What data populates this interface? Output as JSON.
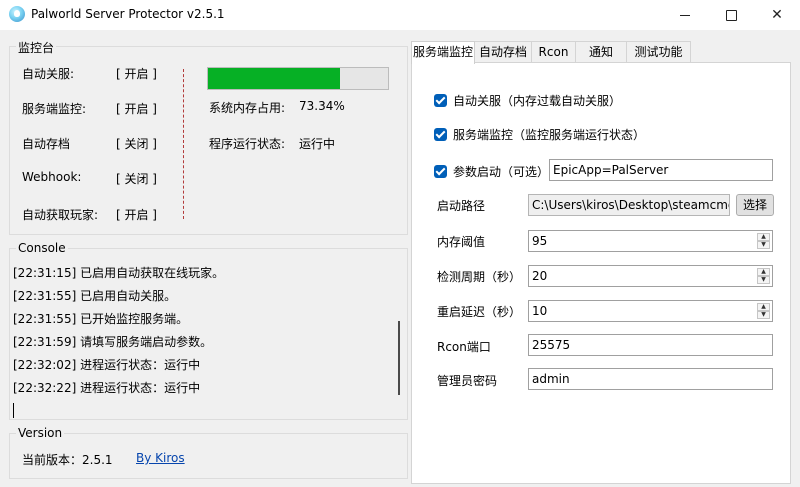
{
  "window": {
    "title": "Palworld Server Protector v2.5.1"
  },
  "monitor": {
    "title": "监控台",
    "rows": [
      {
        "label": "自动关服:",
        "value": "[ 开启 ]"
      },
      {
        "label": "服务端监控:",
        "value": "[ 开启 ]"
      },
      {
        "label": "自动存档",
        "value": "[ 关闭 ]"
      },
      {
        "label": "Webhook:",
        "value": "[ 关闭 ]"
      },
      {
        "label": "自动获取玩家:",
        "value": "[ 开启 ]"
      }
    ],
    "memory_fraction": 0.7334,
    "memory_label": "系统内存占用:",
    "memory_value": "73.34%",
    "status_label": "程序运行状态:",
    "status_value": "运行中",
    "accent_color": "#06b025"
  },
  "console": {
    "title": "Console",
    "lines": [
      "[22:31:15] 已启用自动获取在线玩家。",
      "[22:31:55] 已启用自动关服。",
      "[22:31:55] 已开始监控服务端。",
      "[22:31:59] 请填写服务端启动参数。",
      "[22:32:02] 进程运行状态：运行中",
      "[22:32:22] 进程运行状态：运行中"
    ]
  },
  "version": {
    "title": "Version",
    "label": "当前版本：2.5.1",
    "link": "By Kiros"
  },
  "tabs": [
    {
      "label": "服务端监控",
      "active": true
    },
    {
      "label": "自动存档",
      "active": false
    },
    {
      "label": "Rcon",
      "active": false
    },
    {
      "label": "通知",
      "active": false
    },
    {
      "label": "测试功能",
      "active": false
    }
  ],
  "settings": {
    "auto_shutdown": {
      "label": "自动关服（内存过载自动关服）",
      "checked": true
    },
    "server_monitor": {
      "label": "服务端监控（监控服务端运行状态）",
      "checked": true
    },
    "launch_args": {
      "label": "参数启动（可选）",
      "checked": true,
      "value": "EpicApp=PalServer"
    },
    "start_path": {
      "label": "启动路径",
      "value": "C:\\Users\\kiros\\Desktop\\steamcmd",
      "button": "选择"
    },
    "memory_threshold": {
      "label": "内存阈值",
      "value": "95"
    },
    "check_interval": {
      "label": "检测周期（秒）",
      "value": "20"
    },
    "restart_delay": {
      "label": "重启延迟（秒）",
      "value": "10"
    },
    "rcon_port": {
      "label": "Rcon端口",
      "value": "25575"
    },
    "admin_password": {
      "label": "管理员密码",
      "value": "admin"
    }
  },
  "icons": {
    "app": "palworld-app-icon",
    "minimize": "minimize-icon",
    "maximize": "maximize-icon",
    "close": "close-icon",
    "check": "check-icon",
    "spin_up": "arrow-up-icon",
    "spin_down": "arrow-down-icon"
  }
}
